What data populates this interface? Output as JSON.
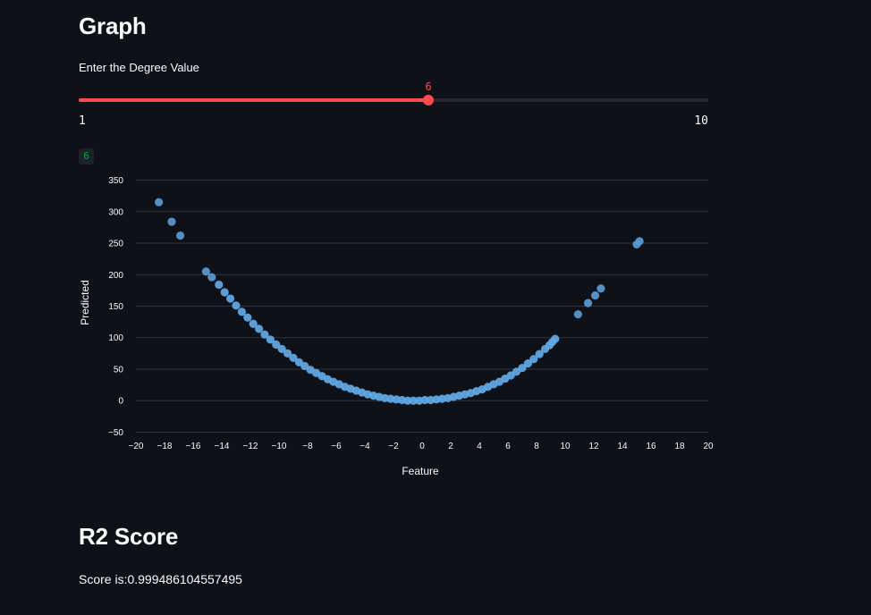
{
  "graph_section": {
    "title": "Graph"
  },
  "slider": {
    "label": "Enter the Degree Value",
    "min": 1,
    "max": 10,
    "value": 6,
    "min_label": "1",
    "max_label": "10",
    "value_label": "6"
  },
  "output_badge": "6",
  "colors": {
    "background": "#0e1117",
    "accent": "#ff4b4b",
    "point": "#62a9e6",
    "grid": "#31333f",
    "badge_text": "#09ab3b"
  },
  "chart_data": {
    "type": "scatter",
    "xlabel": "Feature",
    "ylabel": "Predicted",
    "xlim": [
      -20,
      20
    ],
    "ylim": [
      -55,
      355
    ],
    "xticks": [
      -20,
      -18,
      -16,
      -14,
      -12,
      -10,
      -8,
      -6,
      -4,
      -2,
      0,
      2,
      4,
      6,
      8,
      10,
      12,
      14,
      16,
      18,
      20
    ],
    "yticks": [
      -50,
      0,
      50,
      100,
      150,
      200,
      250,
      300,
      350
    ],
    "grid": "horizontal",
    "series": [
      {
        "points": [
          [
            -18.4,
            315
          ],
          [
            -17.5,
            284
          ],
          [
            -16.9,
            262
          ],
          [
            -15.1,
            205
          ],
          [
            -14.7,
            196
          ],
          [
            -14.2,
            184
          ],
          [
            -13.8,
            172
          ],
          [
            -13.4,
            162
          ],
          [
            -13.0,
            151
          ],
          [
            -12.6,
            141
          ],
          [
            -12.2,
            132
          ],
          [
            -11.8,
            122
          ],
          [
            -11.4,
            114
          ],
          [
            -11.0,
            105
          ],
          [
            -10.6,
            97
          ],
          [
            -10.2,
            89
          ],
          [
            -9.8,
            82
          ],
          [
            -9.4,
            75
          ],
          [
            -9.0,
            68
          ],
          [
            -8.6,
            61
          ],
          [
            -8.2,
            55
          ],
          [
            -7.8,
            49
          ],
          [
            -7.4,
            44
          ],
          [
            -7.0,
            39
          ],
          [
            -6.6,
            34
          ],
          [
            -6.2,
            30
          ],
          [
            -5.8,
            26
          ],
          [
            -5.4,
            22
          ],
          [
            -5.0,
            19
          ],
          [
            -4.6,
            16
          ],
          [
            -4.2,
            13
          ],
          [
            -3.8,
            10
          ],
          [
            -3.4,
            8
          ],
          [
            -3.0,
            6
          ],
          [
            -2.6,
            4
          ],
          [
            -2.2,
            3
          ],
          [
            -1.8,
            2
          ],
          [
            -1.4,
            1
          ],
          [
            -1.0,
            0
          ],
          [
            -0.6,
            0
          ],
          [
            -0.2,
            0
          ],
          [
            0.2,
            1
          ],
          [
            0.6,
            1
          ],
          [
            1.0,
            2
          ],
          [
            1.4,
            3
          ],
          [
            1.8,
            4
          ],
          [
            2.2,
            6
          ],
          [
            2.6,
            8
          ],
          [
            3.0,
            10
          ],
          [
            3.4,
            12
          ],
          [
            3.8,
            15
          ],
          [
            4.2,
            18
          ],
          [
            4.6,
            22
          ],
          [
            5.0,
            26
          ],
          [
            5.4,
            30
          ],
          [
            5.8,
            35
          ],
          [
            6.2,
            40
          ],
          [
            6.6,
            46
          ],
          [
            7.0,
            52
          ],
          [
            7.4,
            59
          ],
          [
            7.8,
            66
          ],
          [
            8.2,
            74
          ],
          [
            8.6,
            82
          ],
          [
            8.9,
            88
          ],
          [
            9.1,
            93
          ],
          [
            9.3,
            98
          ],
          [
            10.9,
            137
          ],
          [
            11.6,
            155
          ],
          [
            12.1,
            167
          ],
          [
            12.5,
            178
          ],
          [
            15.0,
            248
          ],
          [
            15.2,
            253
          ]
        ]
      }
    ]
  },
  "r2_section": {
    "title": "R2 Score",
    "score_text": "Score is:0.999486104557495"
  }
}
